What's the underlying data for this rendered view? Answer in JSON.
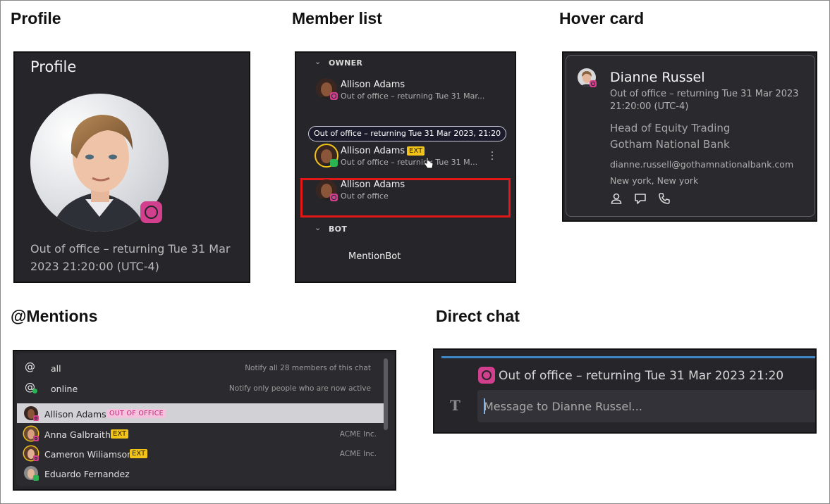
{
  "sections": {
    "profile": "Profile",
    "member_list": "Member list",
    "hover_card": "Hover card",
    "mentions": "@Mentions",
    "direct_chat": "Direct chat"
  },
  "profile": {
    "title": "Profile",
    "status": "Out of office – returning Tue 31 Mar 2023 21:20:00 (UTC-4)",
    "status_icon": "out-of-office-icon"
  },
  "member_list": {
    "owner_group": "OWNER",
    "bot_group": "BOT",
    "tooltip": "Out of office – returning Tue 31 Mar 2023, 21:20",
    "members": [
      {
        "name": "Allison Adams",
        "sub": "Out of office – returning Tue 31 Mar...",
        "ext": ""
      },
      {
        "name": "Allison Adams",
        "sub": "Out of office – returning Tue 31 M...",
        "ext": "EXT"
      },
      {
        "name": "Allison Adams",
        "sub": "Out of office",
        "ext": ""
      }
    ],
    "bot": "MentionBot",
    "colors": {
      "highlight": "#e01818",
      "ext_badge": "#f2c318",
      "ooo": "#d23f8c"
    }
  },
  "hover_card": {
    "name": "Dianne Russel",
    "status": "Out of office – returning Tue 31 Mar 2023 21:20:00 (UTC-4)",
    "role": "Head of Equity Trading",
    "company": "Gotham National Bank",
    "email": "dianne.russell@gothamnationalbank.com",
    "location": "New york, New york",
    "actions": [
      "profile-icon",
      "chat-icon",
      "phone-icon"
    ]
  },
  "mentions": {
    "items": [
      {
        "label": "all",
        "hint": "Notify all 28 members of this chat"
      },
      {
        "label": "online",
        "hint": "Notify only people who are now active"
      }
    ],
    "people": [
      {
        "name": "Allison Adams",
        "badge": "OUT OF OFFICE",
        "company": ""
      },
      {
        "name": "Anna Galbraith",
        "badge": "EXT",
        "company": "ACME Inc."
      },
      {
        "name": "Cameron Wiliamson",
        "badge": "EXT",
        "company": "ACME Inc."
      },
      {
        "name": "Eduardo Fernandez",
        "badge": "",
        "company": ""
      }
    ]
  },
  "direct_chat": {
    "status": "Out of office – returning Tue 31 Mar 2023 21:20",
    "placeholder": "Message to Dianne Russel...",
    "format_button": "T"
  }
}
